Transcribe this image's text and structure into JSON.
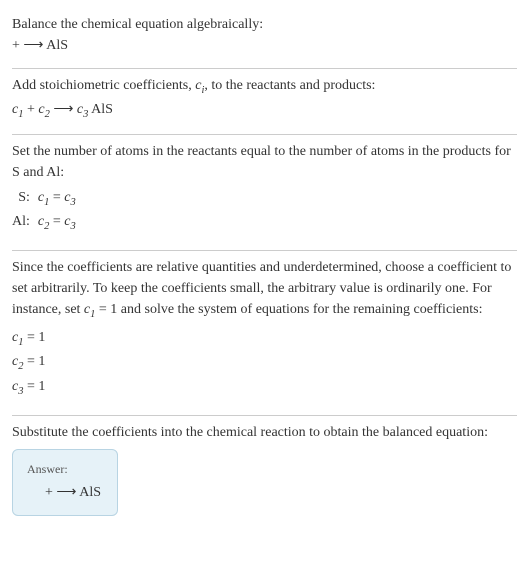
{
  "section1": {
    "title": "Balance the chemical equation algebraically:",
    "equation_prefix": " + ",
    "arrow": "⟶",
    "product": " AlS"
  },
  "section2": {
    "title_a": "Add stoichiometric coefficients, ",
    "title_b": ", to the reactants and products:",
    "c1": "c",
    "c1sub": "1",
    "plus": " + ",
    "c2": "c",
    "c2sub": "2",
    "arrow": " ⟶ ",
    "c3": "c",
    "c3sub": "3",
    "prod": " AlS",
    "ci_c": "c",
    "ci_i": "i"
  },
  "section3": {
    "title": "Set the number of atoms in the reactants equal to the number of atoms in the products for S and Al:",
    "row1_label": "S:",
    "row1_c1": "c",
    "row1_c1sub": "1",
    "row1_eq": " = ",
    "row1_c3": "c",
    "row1_c3sub": "3",
    "row2_label": "Al:",
    "row2_c2": "c",
    "row2_c2sub": "2",
    "row2_eq": " = ",
    "row2_c3": "c",
    "row2_c3sub": "3"
  },
  "section4": {
    "title_a": "Since the coefficients are relative quantities and underdetermined, choose a coefficient to set arbitrarily. To keep the coefficients small, the arbitrary value is ordinarily one. For instance, set ",
    "title_b": " = 1 and solve the system of equations for the remaining coefficients:",
    "set_c": "c",
    "set_csub": "1",
    "l1_c": "c",
    "l1_sub": "1",
    "l1_val": " = 1",
    "l2_c": "c",
    "l2_sub": "2",
    "l2_val": " = 1",
    "l3_c": "c",
    "l3_sub": "3",
    "l3_val": " = 1"
  },
  "section5": {
    "title": "Substitute the coefficients into the chemical reaction to obtain the balanced equation:",
    "answer_label": "Answer:",
    "equation_prefix": " + ",
    "arrow": "⟶",
    "product": " AlS"
  }
}
